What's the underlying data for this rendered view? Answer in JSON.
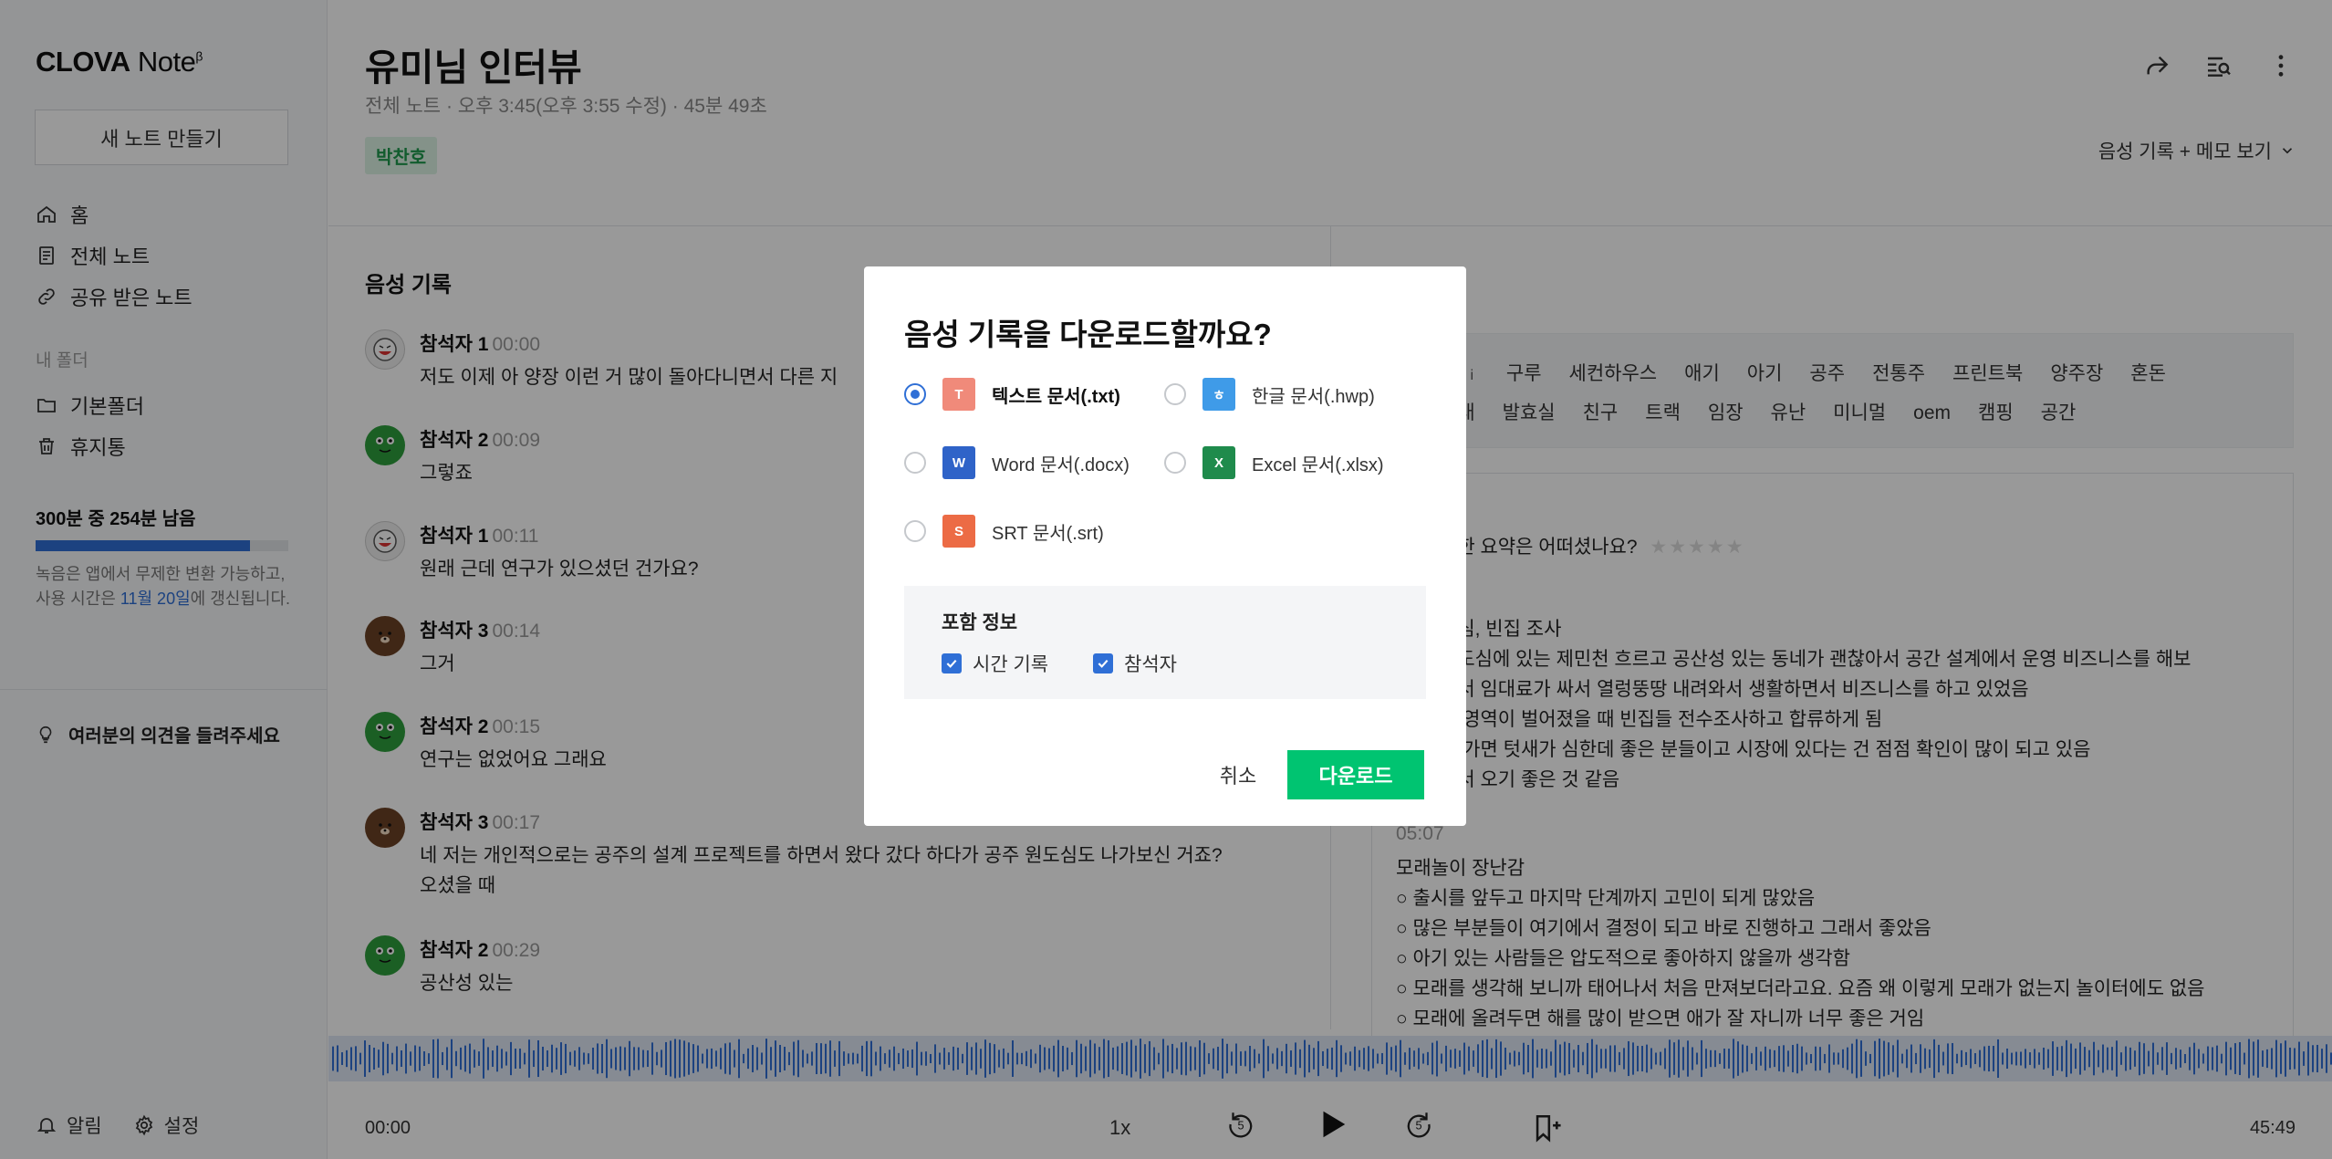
{
  "sidebar": {
    "logo_main": "CLOVA",
    "logo_sub": "Note",
    "logo_beta": "β",
    "new_note": "새 노트 만들기",
    "nav": [
      {
        "label": "홈",
        "icon": "home-icon"
      },
      {
        "label": "전체 노트",
        "icon": "document-icon"
      },
      {
        "label": "공유 받은 노트",
        "icon": "link-icon"
      }
    ],
    "folders_label": "내 폴더",
    "folders": [
      {
        "label": "기본폴더",
        "icon": "folder-icon"
      },
      {
        "label": "휴지통",
        "icon": "trash-icon"
      }
    ],
    "quota_title": "300분 중 254분 남음",
    "quota_fraction": 0.847,
    "quota_note_pre": "녹음은 앱에서 무제한 변환 가능하고, 사용 시간은 ",
    "quota_note_date": "11월 20일",
    "quota_note_post": "에 갱신됩니다.",
    "feedback": "여러분의 의견을 들려주세요",
    "alerts": "알림",
    "settings": "설정"
  },
  "header": {
    "title": "유미님 인터뷰",
    "meta": "전체 노트 · 오후 3:45(오후 3:55 수정) · 45분 49초",
    "tag": "박찬호",
    "view_select": "음성 기록 + 메모 보기"
  },
  "transcript": {
    "title": "음성 기록",
    "messages": [
      {
        "speaker": "참석자 1",
        "time": "00:00",
        "text": "저도 이제 아 양장 이런 거 많이 돌아다니면서 다른 지",
        "avatar": "av1"
      },
      {
        "speaker": "참석자 2",
        "time": "00:09",
        "text": "그렇죠",
        "avatar": "av2"
      },
      {
        "speaker": "참석자 1",
        "time": "00:11",
        "text": "원래 근데 연구가 있으셨던 건가요?",
        "avatar": "av1"
      },
      {
        "speaker": "참석자 3",
        "time": "00:14",
        "text": "그거",
        "avatar": "av3"
      },
      {
        "speaker": "참석자 2",
        "time": "00:15",
        "text": "연구는 없었어요 그래요",
        "avatar": "av2"
      },
      {
        "speaker": "참석자 3",
        "time": "00:17",
        "text": "네 저는 개인적으로는 공주의 설계 프로젝트를 하면서 왔다 갔다 하다가 공주 원도심도 나가보신 거죠?",
        "text2": "오셨을 때",
        "avatar": "av3"
      },
      {
        "speaker": "참석자 2",
        "time": "00:29",
        "text": "공산성 있는",
        "avatar": "av2"
      }
    ]
  },
  "keywords": {
    "label": "워드",
    "row1": [
      "구루",
      "세컨하우스",
      "애기",
      "아기",
      "공주",
      "전통주",
      "프린트북",
      "양주장",
      "혼돈"
    ],
    "row2": [
      "모래",
      "발효실",
      "친구",
      "트랙",
      "임장",
      "유난",
      "미니멀",
      "oem",
      "캠핑",
      "공간"
    ]
  },
  "summary": {
    "rating_q": "정한 요약은 어떠셨나요?",
    "section1_title": "도심, 빈집 조사",
    "lines1": [
      "원도심에 있는 제민천 흐르고 공산성 있는 동네가 괜찮아서 공간 설계에서 운영 비즈니스를 해보",
      "거서 임대료가 싸서 열렁뚱땅 내려와서 생활하면서 비즈니스를 하고 있었음",
      "른 영역이 벌어졌을 때 빈집들 전수조사하고 합류하게 됨",
      "에 가면 텃새가 심한데 좋은 분들이고 시장에 있다는 건 점점 확인이 많이 되고 있음",
      "에서 오기 좋은 것 같음"
    ],
    "section2_time": "05:07",
    "section2_title": "모래놀이 장난감",
    "lines2": [
      "출시를 앞두고 마지막 단계까지 고민이 되게 많았음",
      "많은 부분들이 여기에서 결정이 되고 바로 진행하고 그래서 좋았음",
      "아기 있는 사람들은 압도적으로 좋아하지 않을까 생각함",
      "모래를 생각해 보니까 태어나서 처음 만져보더라고요. 요즘 왜 이렇게 모래가 없는지 놀이터에도 없음",
      "모래에 올려두면 해를 많이 받으면 애가 잘 자니까 너무 좋은 거임"
    ]
  },
  "player": {
    "start": "00:00",
    "end": "45:49",
    "speed": "1x",
    "rewind_seconds": "5",
    "forward_seconds": "5"
  },
  "modal": {
    "title": "음성 기록을 다운로드할까요?",
    "options": [
      {
        "label": "텍스트 문서(.txt)",
        "letter": "T",
        "color": "#f08a7a",
        "selected": true
      },
      {
        "label": "한글 문서(.hwp)",
        "letter": "ㅎ",
        "color": "#3f9be8",
        "selected": false
      },
      {
        "label": "Word 문서(.docx)",
        "letter": "W",
        "color": "#2f63c8",
        "selected": false
      },
      {
        "label": "Excel 문서(.xlsx)",
        "letter": "X",
        "color": "#1f8b4c",
        "selected": false
      },
      {
        "label": "SRT 문서(.srt)",
        "letter": "S",
        "color": "#ec6b45",
        "selected": false
      }
    ],
    "include_title": "포함 정보",
    "include_time": "시간 기록",
    "include_participant": "참석자",
    "cancel": "취소",
    "download": "다운로드"
  },
  "colors": {
    "accent": "#2f6fd6",
    "download_button": "#00c471",
    "tag_bg": "#dcf3e4",
    "tag_text": "#1f9a4d"
  }
}
